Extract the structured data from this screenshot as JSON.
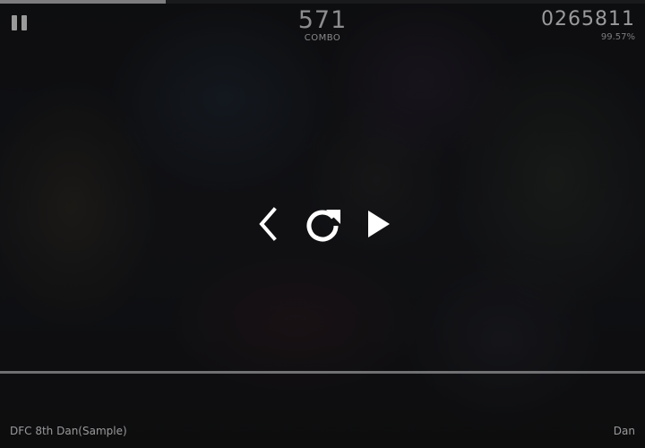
{
  "progress": 0.257,
  "hud": {
    "combo_value": "571",
    "combo_label": "COMBO",
    "score_value": "0265811",
    "accuracy": "99.57%"
  },
  "controls": {
    "back_icon": "chevron-left-icon",
    "retry_icon": "retry-icon",
    "resume_icon": "play-icon",
    "pause_icon": "pause-icon"
  },
  "footer": {
    "song_title": "DFC 8th Dan(Sample)",
    "difficulty": "Dan"
  },
  "colors": {
    "icon": "#ffffff",
    "hud_text": "#9a9a9c",
    "progress_fill": "#7d7d80"
  }
}
